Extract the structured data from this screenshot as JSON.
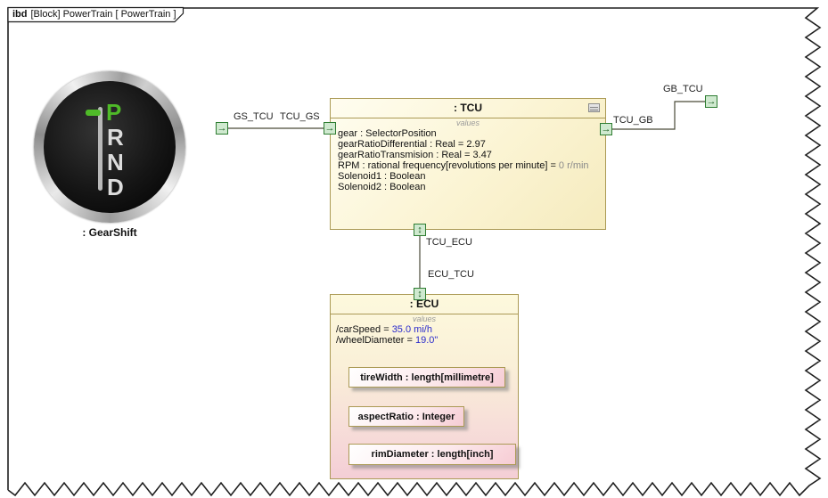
{
  "frame": {
    "kind": "ibd",
    "title": "[Block] PowerTrain [ PowerTrain ]"
  },
  "gearshift": {
    "label": ": GearShift",
    "positions": [
      "P",
      "R",
      "N",
      "D"
    ]
  },
  "ports": {
    "gs_tcu": {
      "label": "GS_TCU",
      "arrow": "→"
    },
    "tcu_gs": {
      "label": "TCU_GS",
      "arrow": "→"
    },
    "tcu_gb": {
      "label": "TCU_GB",
      "arrow": "→"
    },
    "gb_tcu": {
      "label": "GB_TCU",
      "arrow": "→"
    },
    "tcu_ecu": {
      "label": "TCU_ECU",
      "arrow": "↕"
    },
    "ecu_tcu": {
      "label": "ECU_TCU",
      "arrow": "↕"
    }
  },
  "tcu": {
    "title": ": TCU",
    "compartment": "values",
    "properties": [
      {
        "text": "gear : SelectorPosition",
        "value": ""
      },
      {
        "text": "gearRatioDifferential : Real = 2.97",
        "value": ""
      },
      {
        "text": "gearRatioTransmision : Real = 3.47",
        "value": ""
      },
      {
        "text": "RPM : rational frequency[revolutions per minute] =",
        "value": " 0 r/min"
      },
      {
        "text": "Solenoid1 : Boolean",
        "value": ""
      },
      {
        "text": "Solenoid2 : Boolean",
        "value": ""
      }
    ]
  },
  "ecu": {
    "title": ": ECU",
    "compartment": "values",
    "values": [
      {
        "name": "/carSpeed = ",
        "value": "35.0 mi/h"
      },
      {
        "name": "/wheelDiameter = ",
        "value": "19.0\""
      }
    ],
    "parts": [
      {
        "label": "tireWidth : length[millimetre]"
      },
      {
        "label": "aspectRatio : Integer"
      },
      {
        "label": "rimDiameter : length[inch]"
      }
    ]
  },
  "colors": {
    "block_border": "#ab9a55",
    "port_fill": "#cfe9cf",
    "port_border": "#2e7d32",
    "value_blue": "#2b2bcc",
    "gear_green": "#4fba28"
  }
}
